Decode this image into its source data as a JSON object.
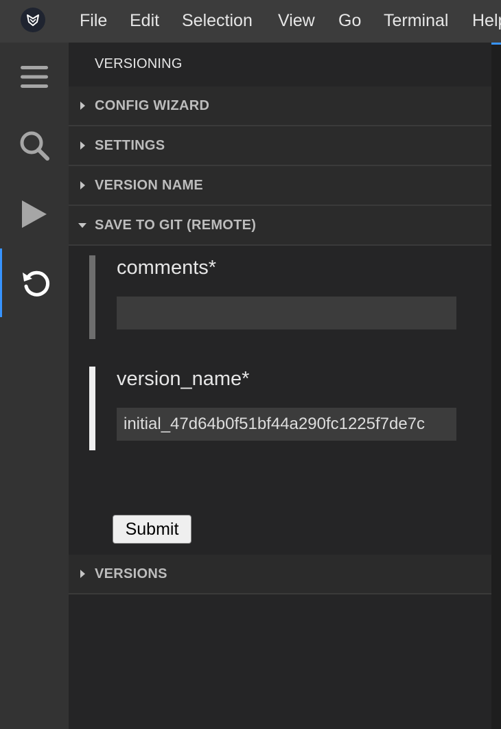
{
  "menubar": {
    "items": [
      "File",
      "Edit",
      "Selection",
      "View",
      "Go",
      "Terminal",
      "Help"
    ]
  },
  "activitybar": {
    "icons": [
      "menu-icon",
      "search-icon",
      "run-icon",
      "versioning-icon"
    ],
    "active": "versioning-icon",
    "accent_color": "#3794ff"
  },
  "sidepanel": {
    "title": "VERSIONING",
    "sections": [
      {
        "label": "CONFIG WIZARD",
        "expanded": false
      },
      {
        "label": "SETTINGS",
        "expanded": false
      },
      {
        "label": "VERSION NAME",
        "expanded": false
      },
      {
        "label": "SAVE TO GIT (REMOTE)",
        "expanded": true
      },
      {
        "label": "VERSIONS",
        "expanded": false
      }
    ]
  },
  "form": {
    "comments_label": "comments*",
    "comments_value": "",
    "version_label": "version_name*",
    "version_value": "initial_47d64b0f51bf44a290fc1225f7de7c",
    "submit_label": "Submit"
  }
}
